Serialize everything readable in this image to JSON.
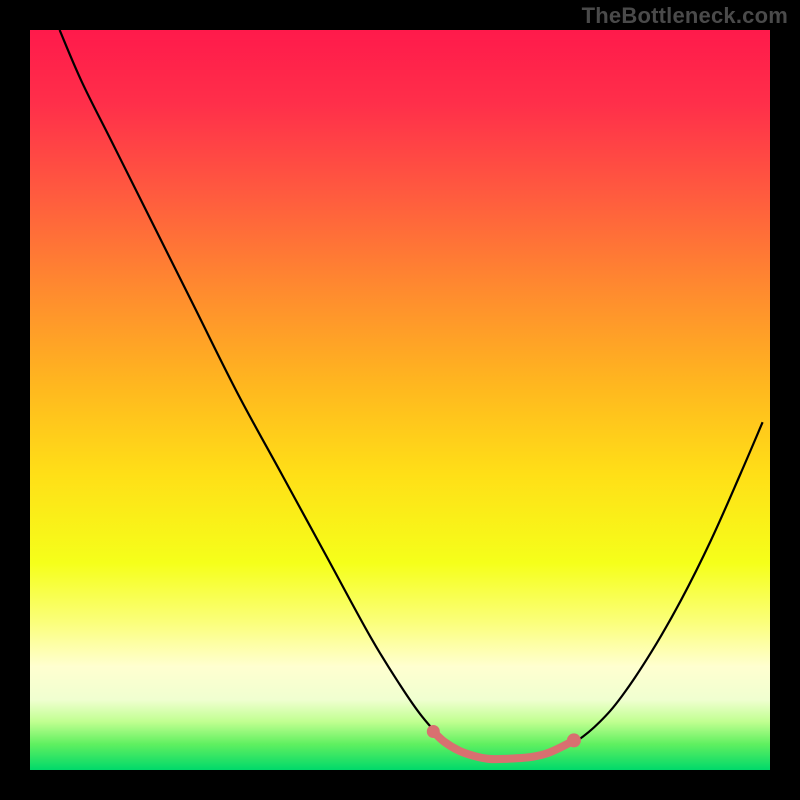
{
  "watermark": "TheBottleneck.com",
  "chart_data": {
    "type": "line",
    "title": "",
    "xlabel": "",
    "ylabel": "",
    "xlim": [
      0,
      100
    ],
    "ylim": [
      0,
      100
    ],
    "background_gradient": {
      "stops": [
        {
          "offset": 0.0,
          "color": "#ff1a4b"
        },
        {
          "offset": 0.1,
          "color": "#ff2f4a"
        },
        {
          "offset": 0.22,
          "color": "#ff5a3f"
        },
        {
          "offset": 0.35,
          "color": "#ff8a2f"
        },
        {
          "offset": 0.48,
          "color": "#ffb71f"
        },
        {
          "offset": 0.6,
          "color": "#ffdf17"
        },
        {
          "offset": 0.72,
          "color": "#f5ff1a"
        },
        {
          "offset": 0.8,
          "color": "#fbff7a"
        },
        {
          "offset": 0.86,
          "color": "#ffffd0"
        },
        {
          "offset": 0.905,
          "color": "#f0ffd0"
        },
        {
          "offset": 0.935,
          "color": "#c0ff90"
        },
        {
          "offset": 0.965,
          "color": "#60f060"
        },
        {
          "offset": 1.0,
          "color": "#00d96a"
        }
      ]
    },
    "series": [
      {
        "name": "bottleneck-curve",
        "color": "#000000",
        "width": 2.2,
        "points": [
          {
            "x": 4.0,
            "y": 100.0
          },
          {
            "x": 7.0,
            "y": 93.0
          },
          {
            "x": 11.0,
            "y": 85.0
          },
          {
            "x": 16.0,
            "y": 75.0
          },
          {
            "x": 22.0,
            "y": 63.0
          },
          {
            "x": 28.0,
            "y": 51.0
          },
          {
            "x": 34.0,
            "y": 40.0
          },
          {
            "x": 40.0,
            "y": 29.0
          },
          {
            "x": 46.0,
            "y": 18.0
          },
          {
            "x": 50.0,
            "y": 11.5
          },
          {
            "x": 53.0,
            "y": 7.2
          },
          {
            "x": 56.0,
            "y": 4.0
          },
          {
            "x": 59.0,
            "y": 2.2
          },
          {
            "x": 62.0,
            "y": 1.5
          },
          {
            "x": 65.0,
            "y": 1.5
          },
          {
            "x": 68.0,
            "y": 1.7
          },
          {
            "x": 71.0,
            "y": 2.5
          },
          {
            "x": 74.0,
            "y": 4.0
          },
          {
            "x": 77.0,
            "y": 6.5
          },
          {
            "x": 80.0,
            "y": 10.0
          },
          {
            "x": 84.0,
            "y": 16.0
          },
          {
            "x": 88.0,
            "y": 23.0
          },
          {
            "x": 92.0,
            "y": 31.0
          },
          {
            "x": 96.0,
            "y": 40.0
          },
          {
            "x": 99.0,
            "y": 47.0
          }
        ]
      },
      {
        "name": "optimal-band",
        "color": "#d87070",
        "width": 8.0,
        "cap": "round",
        "points": [
          {
            "x": 54.5,
            "y": 5.2
          },
          {
            "x": 56.0,
            "y": 3.8
          },
          {
            "x": 58.0,
            "y": 2.6
          },
          {
            "x": 60.0,
            "y": 1.9
          },
          {
            "x": 62.0,
            "y": 1.5
          },
          {
            "x": 64.0,
            "y": 1.5
          },
          {
            "x": 66.0,
            "y": 1.6
          },
          {
            "x": 68.0,
            "y": 1.8
          },
          {
            "x": 70.0,
            "y": 2.3
          },
          {
            "x": 72.0,
            "y": 3.2
          },
          {
            "x": 73.5,
            "y": 4.0
          }
        ]
      },
      {
        "name": "optimal-marker-left",
        "type": "point",
        "color": "#d87070",
        "radius": 6.5,
        "x": 54.5,
        "y": 5.2
      },
      {
        "name": "optimal-marker-right",
        "type": "point",
        "color": "#d87070",
        "radius": 7.0,
        "x": 73.5,
        "y": 4.0
      }
    ]
  }
}
